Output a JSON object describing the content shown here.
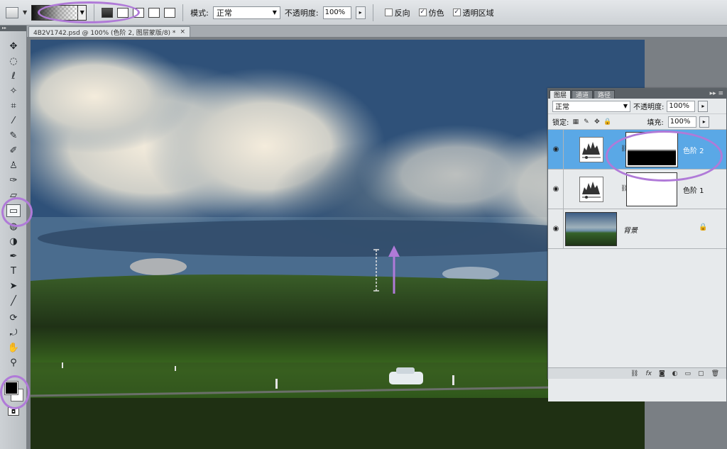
{
  "options_bar": {
    "mode_label": "模式:",
    "mode_value": "正常",
    "opacity_label": "不透明度:",
    "opacity_value": "100%",
    "reverse_label": "反向",
    "dither_label": "仿色",
    "transparency_label": "透明区域",
    "reverse_checked": false,
    "dither_checked": true,
    "transparency_checked": true
  },
  "document_tab": {
    "title": "4B2V1742.psd @ 100% (色阶 2, 图层蒙版/8) *",
    "close": "×"
  },
  "layers_panel": {
    "tabs": [
      "图层",
      "通道",
      "路径"
    ],
    "active_tab": "图层",
    "blend_mode": "正常",
    "opacity_label": "不透明度:",
    "opacity_value": "100%",
    "lock_label": "锁定:",
    "fill_label": "填充:",
    "fill_value": "100%",
    "layers": [
      {
        "name": "色阶 2",
        "selected": true,
        "mask": "gradient"
      },
      {
        "name": "色阶 1",
        "selected": false,
        "mask": "white"
      },
      {
        "name": "背景",
        "selected": false,
        "locked": true
      }
    ]
  },
  "colors": {
    "foreground": "#000000",
    "background": "#ffffff",
    "annotation": "#b07ad8",
    "selection": "#5aa8e6"
  }
}
